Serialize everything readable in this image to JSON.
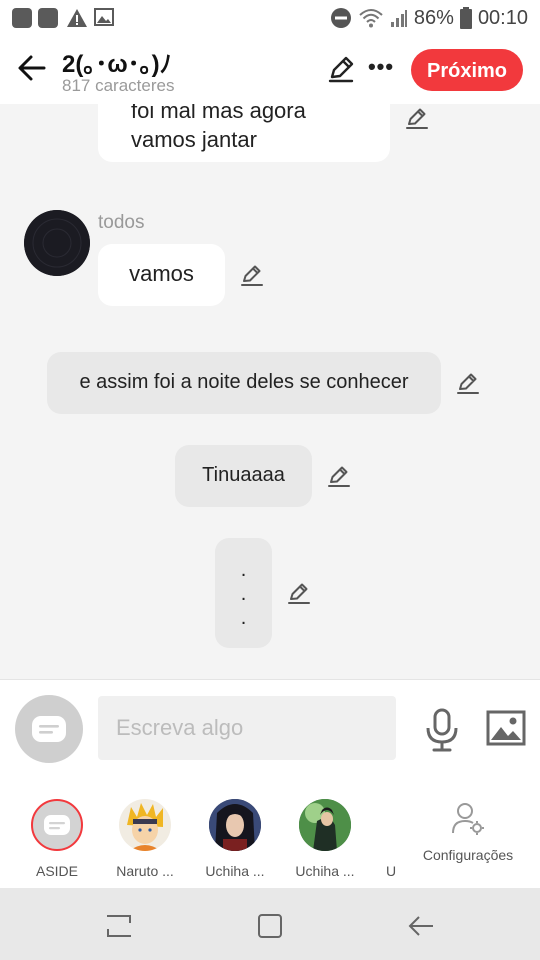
{
  "status_bar": {
    "battery": "86%",
    "time": "00:10",
    "icons": [
      "notification-square-icon",
      "notification-square-icon",
      "warning-icon",
      "image-icon",
      "do-not-disturb-icon",
      "wifi-icon",
      "signal-icon",
      "battery-icon"
    ]
  },
  "header": {
    "title": "2(｡･ω･｡)ﾉ",
    "subtitle": "817 caracteres",
    "next_label": "Próximo",
    "accent_color": "#f2393d"
  },
  "messages": [
    {
      "type": "text",
      "align": "left",
      "lines": [
        "foi mal mas agora",
        "vamos jantar"
      ]
    },
    {
      "type": "text",
      "align": "left",
      "sender": "todos",
      "text": "vamos"
    },
    {
      "type": "narration",
      "text": "e assim foi a noite deles se conhecer"
    },
    {
      "type": "narration",
      "text": "Tinuaaaa"
    },
    {
      "type": "narration",
      "lines": [
        ".",
        ".",
        "."
      ]
    }
  ],
  "composer": {
    "placeholder": "Escreva algo"
  },
  "characters": [
    {
      "label": "ASIDE"
    },
    {
      "label": "Naruto ..."
    },
    {
      "label": "Uchiha ..."
    },
    {
      "label": "Uchiha ..."
    },
    {
      "label": "U"
    }
  ],
  "settings_label": "Configurações"
}
